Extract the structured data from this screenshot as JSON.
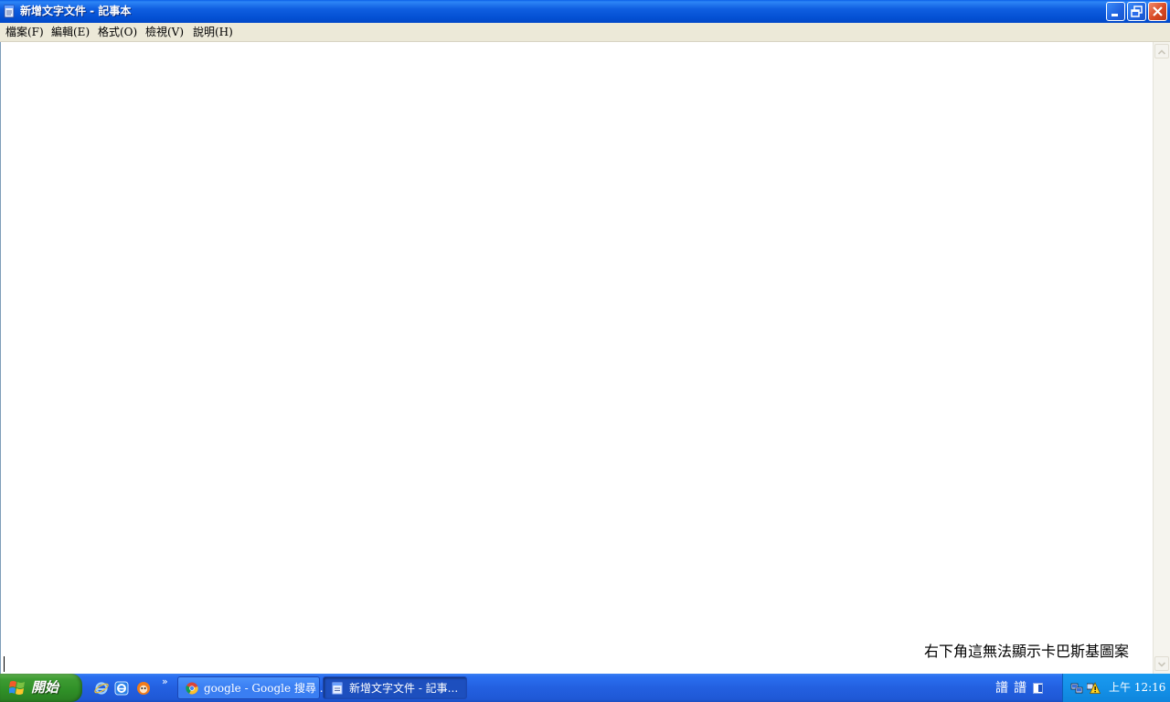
{
  "window": {
    "title": "新增文字文件 - 記事本"
  },
  "menu": {
    "items": [
      {
        "label": "檔案(F)"
      },
      {
        "label": "編輯(E)"
      },
      {
        "label": "格式(O)"
      },
      {
        "label": "檢視(V)"
      },
      {
        "label": "說明(H)"
      }
    ]
  },
  "editor": {
    "annotation": "右下角這無法顯示卡巴斯基圖案"
  },
  "taskbar": {
    "start_label": "開始",
    "quick_launch_icons": [
      "internet-explorer-icon",
      "ie-alt-icon",
      "media-icon"
    ],
    "chevron": "»",
    "tasks": [
      {
        "label": "google - Google 搜尋 ...",
        "icon": "chrome-icon"
      },
      {
        "label": "新增文字文件 - 記事...",
        "icon": "notepad-icon"
      }
    ],
    "ime": {
      "icon1": "譜",
      "icon2": "譜"
    },
    "clock": "上午 12:16"
  },
  "colors": {
    "title_bar": "#0054e3",
    "taskbar": "#245edb",
    "start_button": "#3c9b32",
    "tray": "#0f8fe6",
    "menu_bar": "#ece9d8"
  }
}
